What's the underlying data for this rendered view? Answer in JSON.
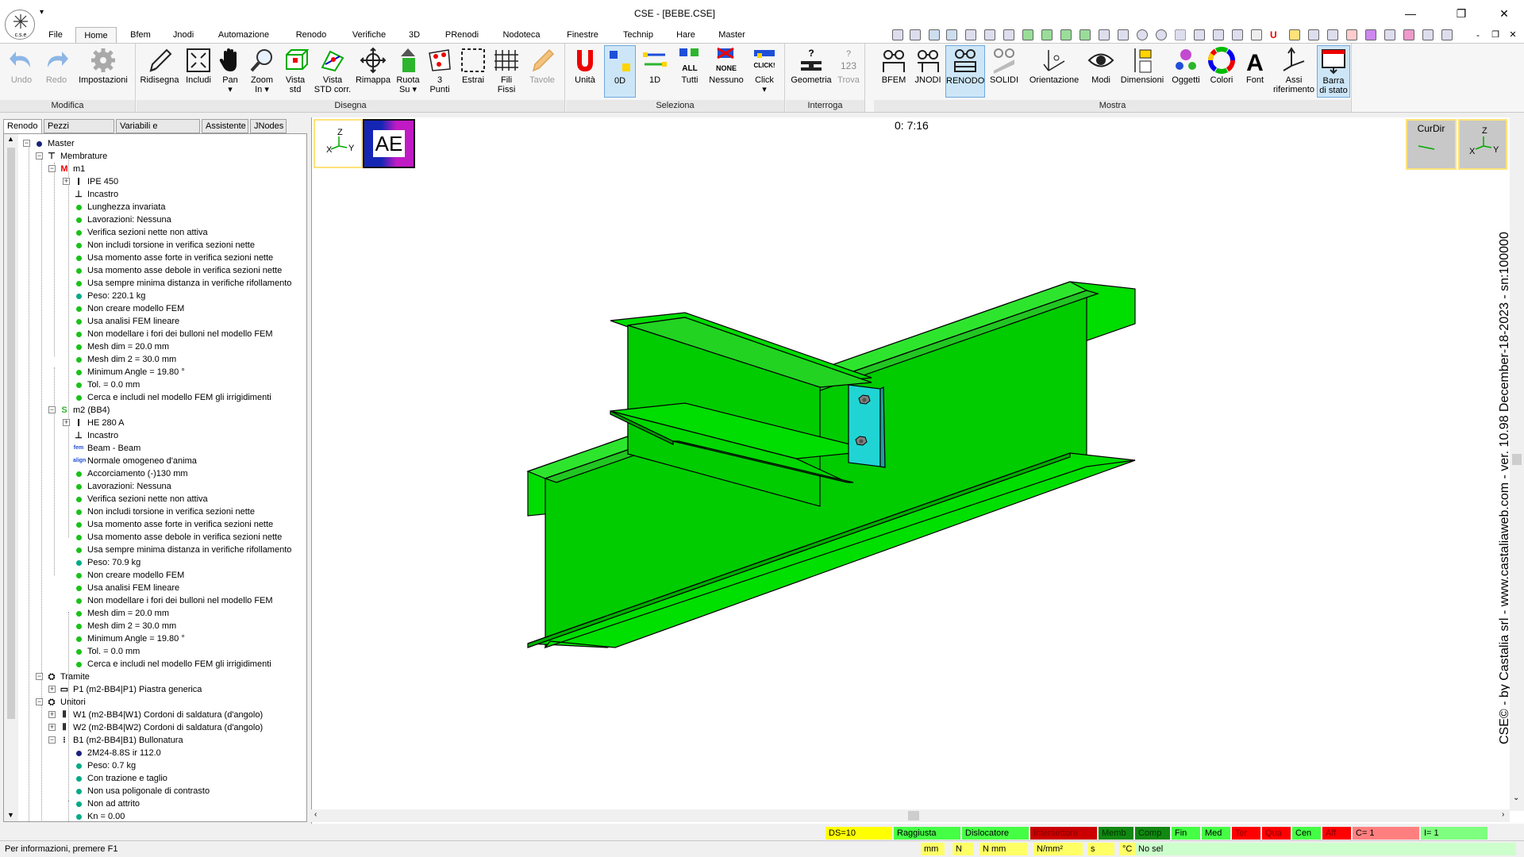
{
  "window": {
    "title": "CSE - [BEBE.CSE]",
    "logo_text": "c.s.e",
    "minimize": "—",
    "restore": "❐",
    "close": "✕",
    "inner_min": "-",
    "inner_restore": "❐",
    "inner_close": "✕"
  },
  "menu": [
    "File",
    "Home",
    "Bfem",
    "Jnodi",
    "Automazione",
    "Renodo",
    "Verifiche",
    "3D",
    "PRenodi",
    "Nodoteca",
    "Finestre",
    "Technip",
    "Hare",
    "Master"
  ],
  "ribbon": {
    "modifica": {
      "label": "Modifica",
      "undo": "Undo",
      "redo": "Redo",
      "impostazioni": "Impostazioni"
    },
    "disegna": {
      "label": "Disegna",
      "ridisegna": "Ridisegna",
      "includi": "Includi",
      "pan": "Pan",
      "zoom_1": "Zoom",
      "zoom_2": "In ▾",
      "vista_std_1": "Vista",
      "vista_std_2": "std",
      "vista_corr_1": "Vista",
      "vista_corr_2": "STD corr.",
      "rimappa": "Rimappa",
      "ruota_1": "Ruota",
      "ruota_2": "Su ▾",
      "punti_1": "3",
      "punti_2": "Punti",
      "estrai": "Estrai",
      "fili_1": "Fili",
      "fili_2": "Fissi",
      "tavole": "Tavole"
    },
    "seleziona": {
      "label": "Seleziona",
      "unita": "Unità",
      "od": "0D",
      "one_d": "1D",
      "tutti": "Tutti",
      "nessuno": "Nessuno",
      "click": "Click",
      "click_caret": "▾",
      "all_text": "ALL",
      "none_text": "NONE",
      "click_text": "CLICK!"
    },
    "interroga": {
      "label": "Interroga",
      "geometria": "Geometria",
      "trova": "Trova",
      "trova_glyph_1": "?",
      "trova_glyph_2": "123",
      "geom_glyph": "?"
    },
    "mostra": {
      "label": "Mostra",
      "bfem": "BFEM",
      "jnodi": "JNODI",
      "renodo": "RENODO",
      "solidi": "SOLIDI",
      "orientazione": "Orientazione",
      "modi": "Modi",
      "dimensioni": "Dimensioni",
      "oggetti": "Oggetti",
      "colori": "Colori",
      "font": "Font",
      "font_glyph": "A",
      "assi_1": "Assi",
      "assi_2": "riferimento",
      "barra_1": "Barra",
      "barra_2": "di stato"
    }
  },
  "left_tabs": [
    "Renodo",
    "Pezzi selezionati",
    "Variabili e condizioni",
    "Assistente",
    "JNodes"
  ],
  "tree": {
    "master": "Master",
    "membrature": "Membrature",
    "m1": {
      "label": "m1",
      "tag": "M",
      "section": "IPE 450",
      "constraint": "Incastro",
      "props": [
        "Lunghezza invariata",
        "Lavorazioni: Nessuna",
        "Verifica sezioni nette non attiva",
        "Non includi torsione in verifica sezioni nette",
        "Usa momento asse forte in verifica sezioni nette",
        "Usa momento asse debole in verifica sezioni nette",
        "Usa sempre minima distanza in verifiche rifollamento",
        "Peso:    220.1 kg",
        "Non creare modello FEM",
        "Usa analisi FEM lineare",
        "Non modellare i fori dei bulloni nel modello FEM",
        "Mesh dim =  20.0 mm",
        "Mesh dim 2 =  30.0 mm",
        "Minimum Angle = 19.80 °",
        "Tol. =   0.0 mm",
        "Cerca e includi nel modello FEM gli irrigidimenti"
      ]
    },
    "m2": {
      "label": "m2 (BB4)",
      "tag": "S",
      "section": "HE 280 A",
      "constraint": "Incastro",
      "beam_tag": "fem",
      "beam": "Beam - Beam",
      "align_tag": "align",
      "align": "Normale omogeneo d'anima",
      "props": [
        "Accorciamento (-)130  mm",
        "Lavorazioni: Nessuna",
        "Verifica sezioni nette non attiva",
        "Non includi torsione in verifica sezioni nette",
        "Usa momento asse forte in verifica sezioni nette",
        "Usa momento asse debole in verifica sezioni nette",
        "Usa sempre minima distanza in verifiche rifollamento",
        "Peso:     70.9 kg",
        "Non creare modello FEM",
        "Usa analisi FEM lineare",
        "Non modellare i fori dei bulloni nel modello FEM",
        "Mesh dim =  20.0 mm",
        "Mesh dim 2 =  30.0 mm",
        "Minimum Angle = 19.80 °",
        "Tol. =   0.0 mm",
        "Cerca e includi nel modello FEM gli irrigidimenti"
      ]
    },
    "tramite": "Tramite",
    "p1": "P1 (m2-BB4|P1)  Piastra generica",
    "unitori": "Unitori",
    "w1": "W1 (m2-BB4|W1)  Cordoni di saldatura (d'angolo)",
    "w2": "W2 (m2-BB4|W2)  Cordoni di saldatura (d'angolo)",
    "b1": "B1 (m2-BB4|B1)  Bullonatura",
    "b1_props": [
      "2M24-8.8S ir 112.0",
      "Peso:      0.7 kg",
      "Con trazione e taglio",
      "Non usa poligonale di contrasto",
      "Non ad attrito",
      "Kn =     0.00"
    ]
  },
  "viewport": {
    "timer": "0: 7:16",
    "ae_label": "AE",
    "curdir": "CurDir",
    "axis_x": "X",
    "axis_y": "Y",
    "axis_z": "Z",
    "watermark": "CSE© - by Castalia srl - www.castaliaweb.com - ver. 10.98 December-18-2023 - sn:100000"
  },
  "statusbar": {
    "ds": "DS=10",
    "raggiusta": "Raggiusta",
    "dislocatore": "Dislocatore",
    "intersettore": "Intersettore",
    "memb": "Memb",
    "comp": "Comp",
    "fin": "Fin",
    "med": "Med",
    "ter": "Ter",
    "qua": "Qua",
    "cen": "Cen",
    "aff": "Aff",
    "c_eq": "C= 1",
    "i_eq": "I= 1",
    "info": "Per informazioni, premere F1",
    "unit_mm": "mm",
    "unit_n": "N",
    "unit_nmm": "N mm",
    "unit_stress": "N/mm²",
    "unit_s": "s",
    "unit_c": "°C",
    "nosel": "No sel"
  }
}
